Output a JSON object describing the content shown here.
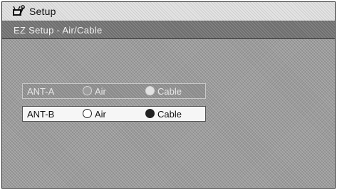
{
  "header": {
    "title": "Setup",
    "icon": "tv-setup-icon"
  },
  "subheader": {
    "title": "EZ Setup - Air/Cable"
  },
  "antennas": [
    {
      "label": "ANT-A",
      "options": [
        "Air",
        "Cable"
      ],
      "selected": "Cable",
      "focused": false
    },
    {
      "label": "ANT-B",
      "options": [
        "Air",
        "Cable"
      ],
      "selected": "Cable",
      "focused": true
    }
  ],
  "colors": {
    "background": "#9a9a9a",
    "title_bar": "#e4e4e4",
    "sub_bar": "#6e6e6e",
    "focused_row": "#f6f6f6"
  }
}
